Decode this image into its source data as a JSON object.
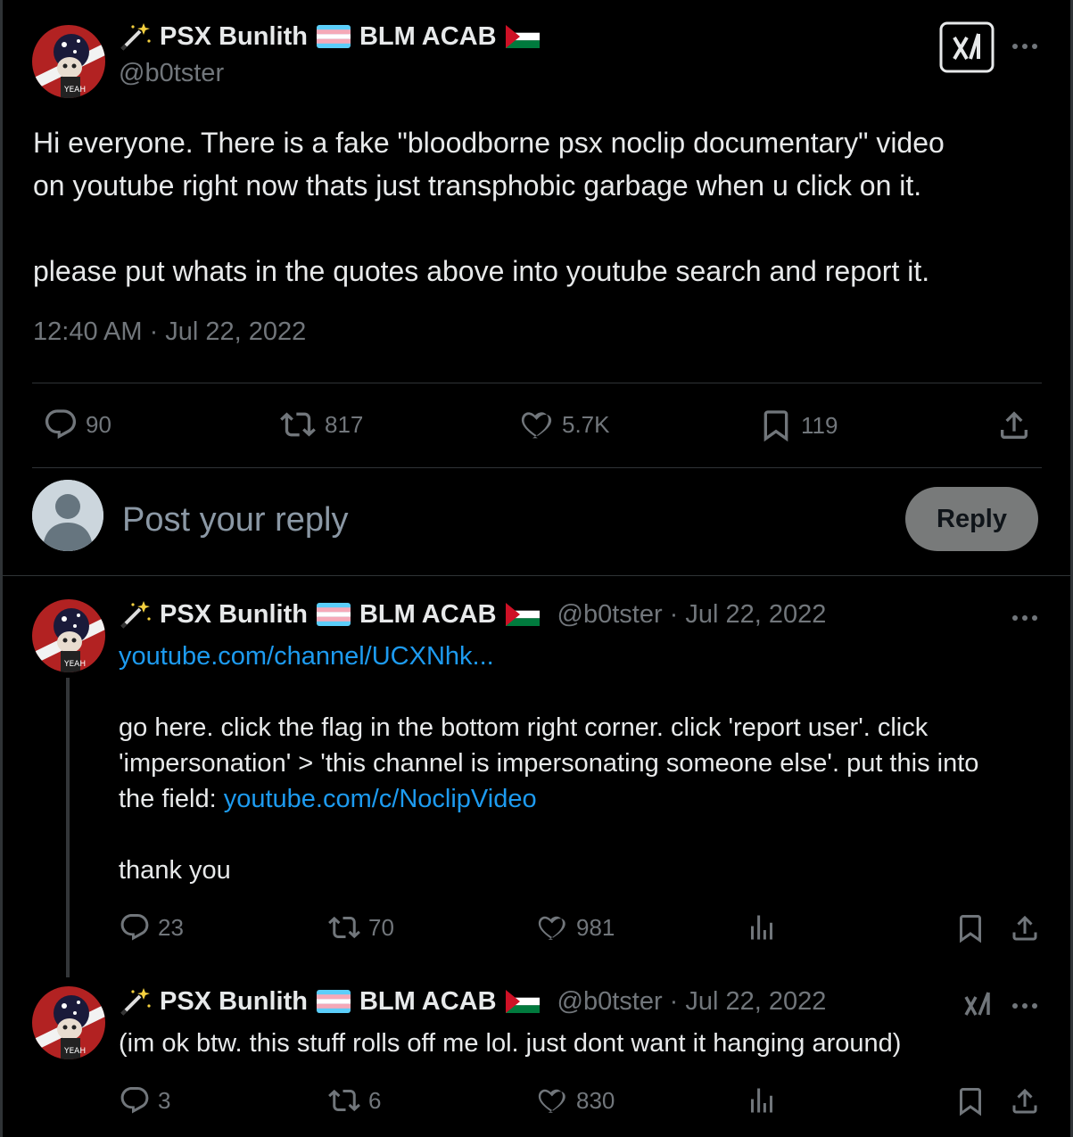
{
  "main_tweet": {
    "display_name": "PSX Bunlith",
    "name_suffix": "BLM ACAB",
    "handle": "@b0tster",
    "text_line1": "Hi everyone. There is a fake \"bloodborne psx noclip documentary\" video",
    "text_line2": "on youtube right now thats just transphobic garbage when u click on it.",
    "text_line3": "please put whats in the quotes above into youtube search and report it.",
    "timestamp": "12:40 AM · Jul 22, 2022",
    "actions": {
      "replies": "90",
      "reposts": "817",
      "likes": "5.7K",
      "bookmarks": "119"
    }
  },
  "reply_box": {
    "placeholder": "Post your reply",
    "button": "Reply"
  },
  "thread": [
    {
      "display_name": "PSX Bunlith",
      "name_suffix": "BLM ACAB",
      "meta": "@b0tster · Jul 22, 2022",
      "link1": "youtube.com/channel/UCXNhk...",
      "line1": "go here. click the flag in the bottom right corner. click 'report user'. click",
      "line2": "'impersonation' > 'this channel is impersonating someone else'. put this into",
      "line3_prefix": "the field: ",
      "link2": "youtube.com/c/NoclipVideo",
      "line4": "thank you",
      "actions": {
        "replies": "23",
        "reposts": "70",
        "likes": "981"
      }
    },
    {
      "display_name": "PSX Bunlith",
      "name_suffix": "BLM ACAB",
      "meta": "@b0tster · Jul 22, 2022",
      "text": "(im ok btw. this stuff rolls off me lol. just dont want it hanging around)",
      "actions": {
        "replies": "3",
        "reposts": "6",
        "likes": "830"
      }
    }
  ],
  "colors": {
    "background": "#000000",
    "text": "#e7e9ea",
    "muted": "#71767b",
    "link": "#1d9bf0",
    "divider": "#2f3336"
  }
}
